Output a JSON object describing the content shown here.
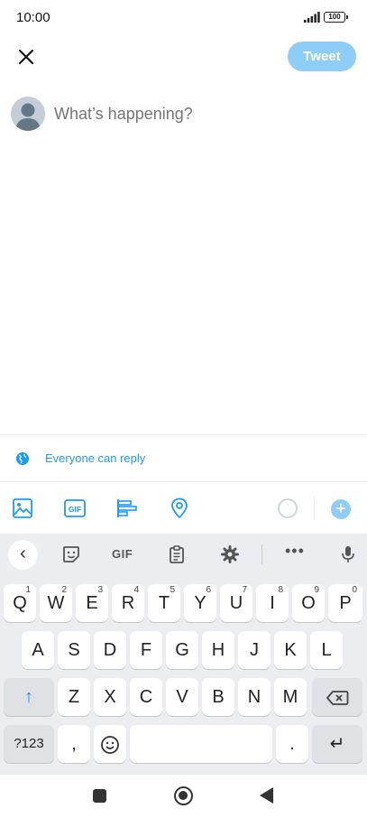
{
  "status_bar": {
    "time": "10:00",
    "battery": "100"
  },
  "compose": {
    "tweet_button": "Tweet",
    "placeholder": "What’s happening?",
    "reply_setting": "Everyone can reply"
  },
  "toolbar": {
    "gif_label": "GIF",
    "add_label": "+"
  },
  "keyboard": {
    "suggestion_bar": {
      "back": "‹",
      "gif": "GIF",
      "more": "•••"
    },
    "row1": [
      {
        "label": "Q",
        "sup": "1"
      },
      {
        "label": "W",
        "sup": "2"
      },
      {
        "label": "E",
        "sup": "3"
      },
      {
        "label": "R",
        "sup": "4"
      },
      {
        "label": "T",
        "sup": "5"
      },
      {
        "label": "Y",
        "sup": "6"
      },
      {
        "label": "U",
        "sup": "7"
      },
      {
        "label": "I",
        "sup": "8"
      },
      {
        "label": "O",
        "sup": "9"
      },
      {
        "label": "P",
        "sup": "0"
      }
    ],
    "row2": [
      "A",
      "S",
      "D",
      "F",
      "G",
      "H",
      "J",
      "K",
      "L"
    ],
    "row3": [
      "Z",
      "X",
      "C",
      "V",
      "B",
      "N",
      "M"
    ],
    "symbols_key": "?123",
    "comma_key": ",",
    "period_key": ".",
    "shift_icon": "↑",
    "enter_icon": "↵"
  },
  "colors": {
    "accent": "#1d9bf0",
    "tweet_button_disabled": "#8ecdf8",
    "keyboard_bg": "#ebedf0"
  }
}
